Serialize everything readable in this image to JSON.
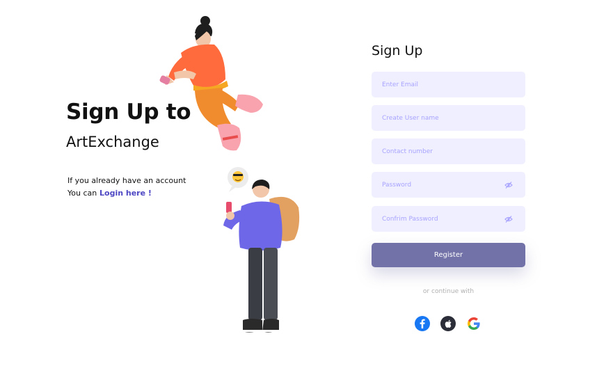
{
  "hero": {
    "title": "Sign Up to",
    "subtitle": "ArtExchange",
    "account_text": "If you already have an account",
    "you_can": "You can",
    "login_link": "Login here !"
  },
  "form": {
    "title": "Sign Up",
    "fields": [
      {
        "placeholder": "Enter Email",
        "value": ""
      },
      {
        "placeholder": "Create User name",
        "value": ""
      },
      {
        "placeholder": "Contact number",
        "value": ""
      },
      {
        "placeholder": "Password",
        "value": ""
      },
      {
        "placeholder": "Confrim Password",
        "value": ""
      }
    ],
    "register_label": "Register",
    "continue_text": "or continue with"
  },
  "social": [
    {
      "icon": "facebook-icon",
      "color": "#1877F2"
    },
    {
      "icon": "apple-icon",
      "color": "#2B2E38"
    },
    {
      "icon": "google-icon",
      "color": "#4285F4"
    }
  ],
  "colors": {
    "accent": "#4D47C3",
    "field_bg": "#F0EFFF",
    "placeholder": "#A7A3FF",
    "button": "#7372A8"
  }
}
